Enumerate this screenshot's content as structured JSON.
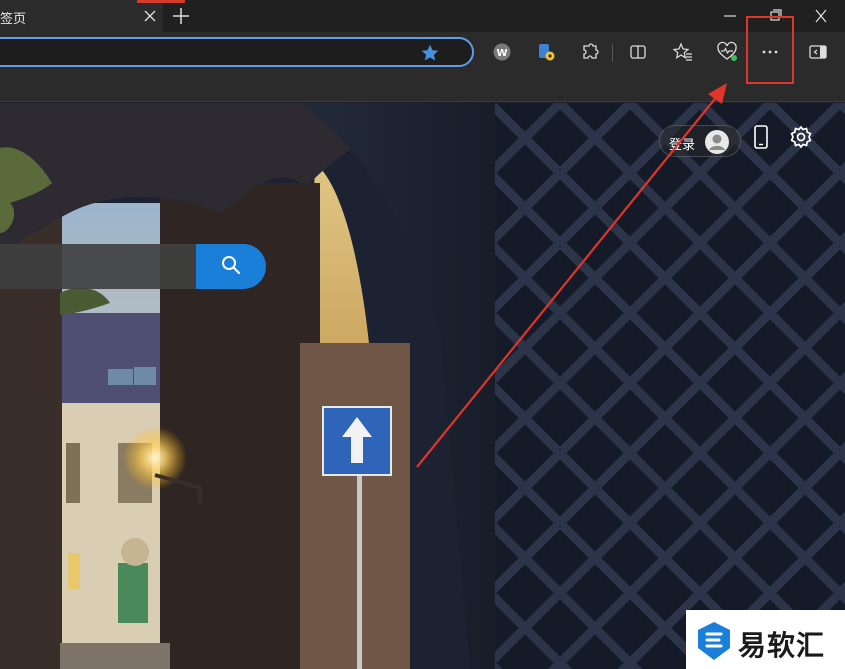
{
  "tab": {
    "title": "签页"
  },
  "address_bar": {
    "text": ""
  },
  "toolbar": {
    "buttons": [
      "profile-w-icon",
      "wallet-icon",
      "extensions-icon",
      "split-screen-icon",
      "favorites-icon",
      "browser-essentials-icon",
      "more-menu-icon",
      "sidebar-toggle-icon"
    ]
  },
  "page": {
    "login_label": "登录"
  },
  "annotation": {
    "color": "#e0352b"
  },
  "watermark": {
    "text": "易软汇"
  },
  "colors": {
    "accent": "#1a7fd8",
    "tab_bar": "#202020",
    "toolbar": "#2b2b2b",
    "address_border": "#5d9de6"
  }
}
